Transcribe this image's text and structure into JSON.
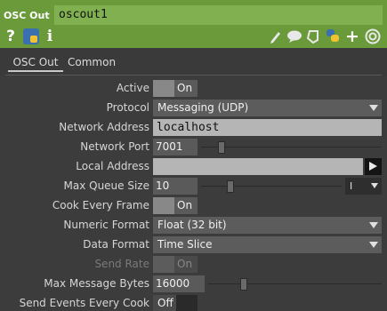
{
  "header": {
    "op_type": "OSC Out",
    "op_name": "oscout1",
    "icons_left": [
      "help-icon",
      "python-help-icon",
      "info-icon"
    ],
    "icons_right": [
      "pencil-icon",
      "comment-icon",
      "clone-icon",
      "python-icon",
      "plus-icon",
      "viewer-icon"
    ],
    "help_glyph": "?",
    "info_glyph": "i",
    "plus_glyph": "+"
  },
  "tabs": [
    {
      "label": "OSC Out"
    },
    {
      "label": "Common"
    }
  ],
  "params": {
    "active": {
      "label": "Active",
      "value": "On"
    },
    "protocol": {
      "label": "Protocol",
      "value": "Messaging (UDP)"
    },
    "network_address": {
      "label": "Network Address",
      "value": "localhost"
    },
    "network_port": {
      "label": "Network Port",
      "value": "7001"
    },
    "local_address": {
      "label": "Local Address",
      "value": ""
    },
    "max_queue_size": {
      "label": "Max Queue Size",
      "value": "10",
      "unit": "I"
    },
    "cook_every_frame": {
      "label": "Cook Every Frame",
      "value": "On"
    },
    "numeric_format": {
      "label": "Numeric Format",
      "value": "Float (32 bit)"
    },
    "data_format": {
      "label": "Data Format",
      "value": "Time Slice"
    },
    "send_rate": {
      "label": "Send Rate",
      "value": "On",
      "disabled": true
    },
    "max_message_bytes": {
      "label": "Max Message Bytes",
      "value": "16000"
    },
    "send_events_every_cook": {
      "label": "Send Events Every Cook",
      "value": "Off"
    }
  },
  "colors": {
    "header_green": "#6a9a3a",
    "name_field": "#80b050",
    "panel_bg": "#3c3c3c"
  }
}
